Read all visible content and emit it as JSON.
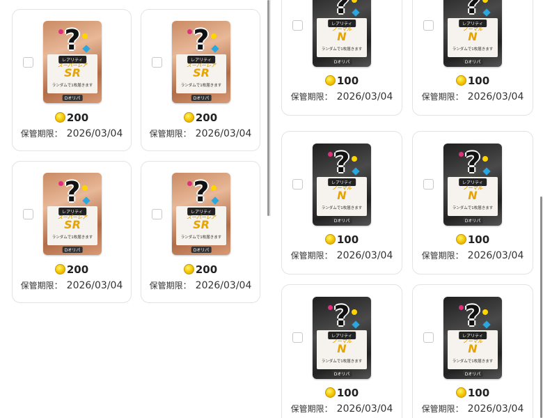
{
  "expiry_label": "保管期限：",
  "cards_left": [
    {
      "rarity_tag": "レアリティ",
      "rarity_name": "スーパーレア",
      "rarity_code": "SR",
      "random_text": "ランダムで1枚届きます",
      "brand": "Dオリパ",
      "price": "200",
      "expiry_date": "2026/03/04"
    },
    {
      "rarity_tag": "レアリティ",
      "rarity_name": "スーパーレア",
      "rarity_code": "SR",
      "random_text": "ランダムで1枚届きます",
      "brand": "Dオリパ",
      "price": "200",
      "expiry_date": "2026/03/04"
    },
    {
      "rarity_tag": "レアリティ",
      "rarity_name": "スーパーレア",
      "rarity_code": "SR",
      "random_text": "ランダムで1枚届きます",
      "brand": "Dオリパ",
      "price": "200",
      "expiry_date": "2026/03/04"
    },
    {
      "rarity_tag": "レアリティ",
      "rarity_name": "スーパーレア",
      "rarity_code": "SR",
      "random_text": "ランダムで1枚届きます",
      "brand": "Dオリパ",
      "price": "200",
      "expiry_date": "2026/03/04"
    }
  ],
  "cards_right": [
    {
      "rarity_tag": "レアリティ",
      "rarity_name": "ノーマル",
      "rarity_code": "N",
      "random_text": "ランダムで1枚届きます",
      "brand": "Dオリパ",
      "price": "100",
      "expiry_date": "2026/03/04"
    },
    {
      "rarity_tag": "レアリティ",
      "rarity_name": "ノーマル",
      "rarity_code": "N",
      "random_text": "ランダムで1枚届きます",
      "brand": "Dオリパ",
      "price": "100",
      "expiry_date": "2026/03/04"
    },
    {
      "rarity_tag": "レアリティ",
      "rarity_name": "ノーマル",
      "rarity_code": "N",
      "random_text": "ランダムで1枚届きます",
      "brand": "Dオリパ",
      "price": "100",
      "expiry_date": "2026/03/04"
    },
    {
      "rarity_tag": "レアリティ",
      "rarity_name": "ノーマル",
      "rarity_code": "N",
      "random_text": "ランダムで1枚届きます",
      "brand": "Dオリパ",
      "price": "100",
      "expiry_date": "2026/03/04"
    },
    {
      "rarity_tag": "レアリティ",
      "rarity_name": "ノーマル",
      "rarity_code": "N",
      "random_text": "ランダムで1枚届きます",
      "brand": "Dオリパ",
      "price": "100",
      "expiry_date": "2026/03/04"
    },
    {
      "rarity_tag": "レアリティ",
      "rarity_name": "ノーマル",
      "rarity_code": "N",
      "random_text": "ランダムで1枚届きます",
      "brand": "Dオリパ",
      "price": "100",
      "expiry_date": "2026/03/04"
    }
  ]
}
